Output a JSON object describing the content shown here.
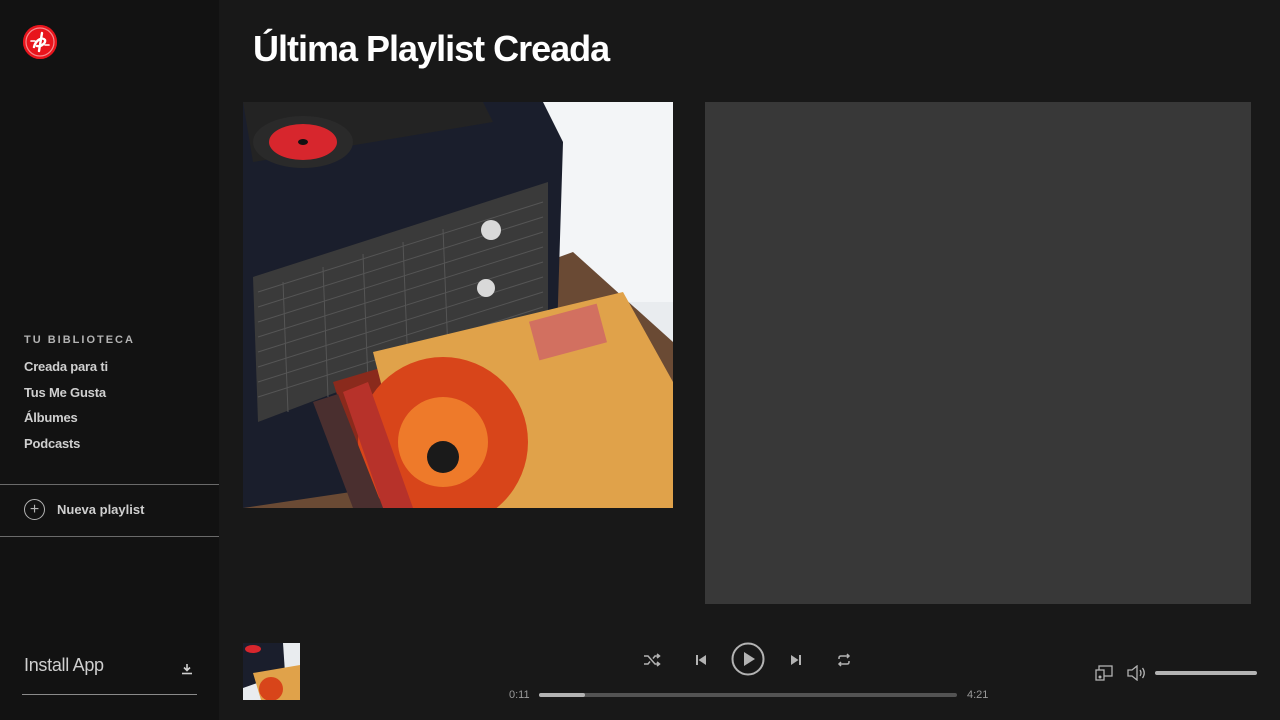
{
  "colors": {
    "accent": "#e8141c",
    "sidebar_bg": "#121212",
    "main_bg": "#181818",
    "panel_bg": "#383838"
  },
  "page": {
    "title": "Última Playlist Creada"
  },
  "sidebar": {
    "library_title": "TU BIBLIOTECA",
    "items": [
      {
        "label": "Creada para ti"
      },
      {
        "label": "Tus Me Gusta"
      },
      {
        "label": "Álbumes"
      },
      {
        "label": "Podcasts"
      }
    ],
    "new_playlist_label": "Nueva playlist",
    "install_label": "Install App"
  },
  "player": {
    "elapsed": "0:11",
    "duration": "4:21",
    "progress": 0.11,
    "volume": 1.0,
    "icons": [
      "shuffle-icon",
      "previous-icon",
      "play-icon",
      "next-icon",
      "repeat-icon",
      "devices-icon",
      "volume-icon"
    ]
  }
}
